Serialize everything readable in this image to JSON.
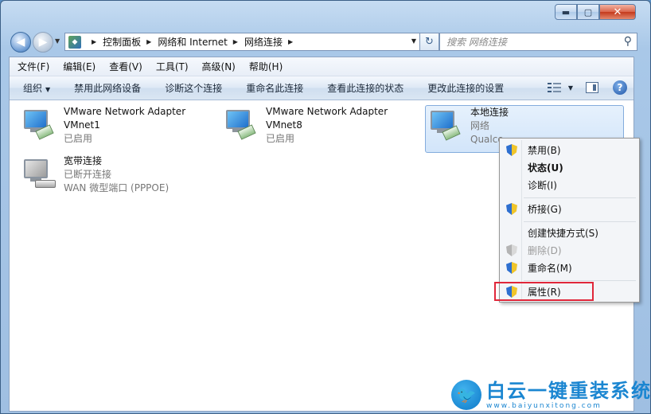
{
  "window": {
    "caption": {
      "minimize": "▬",
      "maximize": "▢",
      "close": "✕"
    }
  },
  "navigation": {
    "back_glyph": "◀",
    "forward_glyph": "▶",
    "breadcrumbs": [
      "控制面板",
      "网络和 Internet",
      "网络连接"
    ],
    "crumb_separator": "▶",
    "refresh_glyph": "↻",
    "search_placeholder": "搜索 网络连接"
  },
  "menu_bar": {
    "items": [
      "文件(F)",
      "编辑(E)",
      "查看(V)",
      "工具(T)",
      "高级(N)",
      "帮助(H)"
    ]
  },
  "command_bar": {
    "organize": "组织",
    "commands": [
      "禁用此网络设备",
      "诊断这个连接",
      "重命名此连接",
      "查看此连接的状态",
      "更改此连接的设置"
    ],
    "help": "?"
  },
  "connections": [
    {
      "name": "VMware Network Adapter",
      "line2": "VMnet1",
      "status": "已启用",
      "icon": "network-adapter-icon"
    },
    {
      "name": "VMware Network Adapter",
      "line2": "VMnet8",
      "status": "已启用",
      "icon": "network-adapter-icon"
    },
    {
      "name": "本地连接",
      "line2": "网络",
      "status": "Qualco",
      "icon": "network-adapter-icon"
    },
    {
      "name": "宽带连接",
      "line2": "已断开连接",
      "status": "WAN 微型端口 (PPPOE)",
      "icon": "broadband-icon"
    }
  ],
  "context_menu": {
    "items": [
      {
        "label": "禁用(B)",
        "shield": true
      },
      {
        "label": "状态(U)",
        "bold": true
      },
      {
        "label": "诊断(I)"
      },
      {
        "label": "桥接(G)",
        "shield": true
      },
      {
        "label": "创建快捷方式(S)"
      },
      {
        "label": "删除(D)",
        "shield": true,
        "disabled": true
      },
      {
        "label": "重命名(M)",
        "shield": true
      },
      {
        "label": "属性(R)",
        "shield": true,
        "highlighted": true
      }
    ]
  },
  "watermark": {
    "brand": "白云一键重装系统",
    "url": "www.baiyunxitong.com"
  },
  "colors": {
    "highlight_box": "#e0273a",
    "selection": "#d2e5fa",
    "watermark": "#1b86d1"
  }
}
